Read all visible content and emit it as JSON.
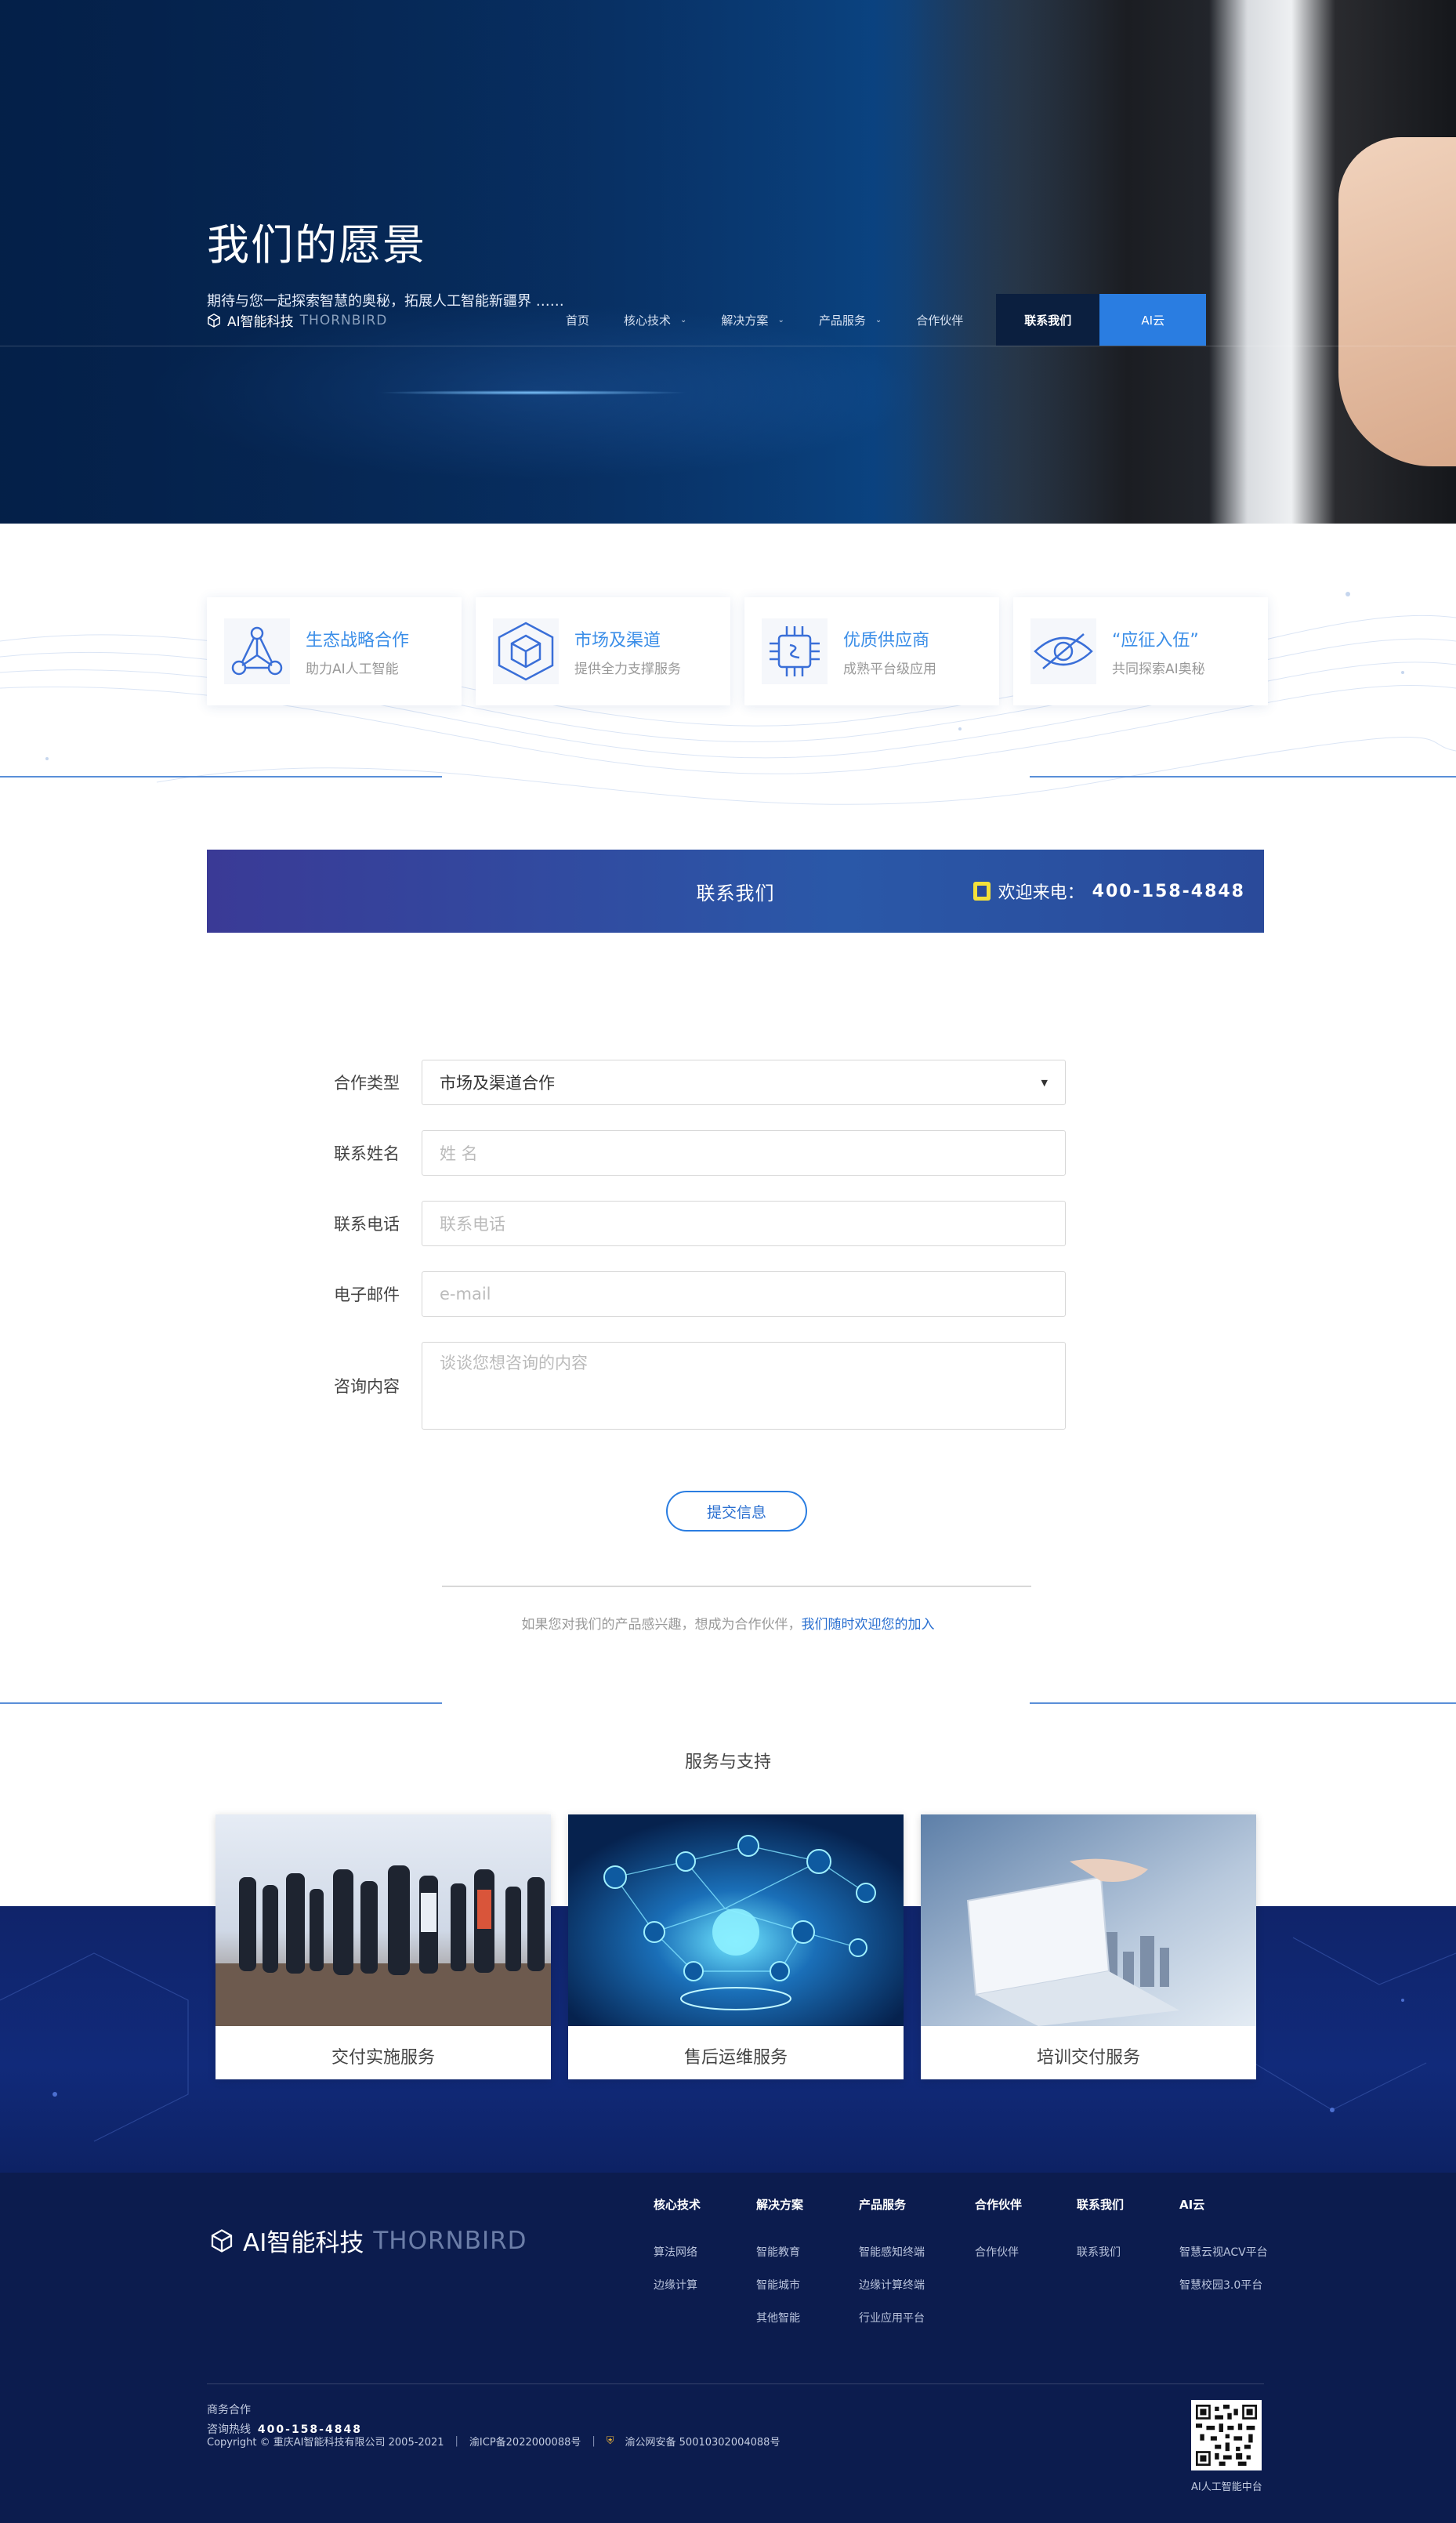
{
  "hero": {
    "title": "我们的愿景",
    "subtitle": "期待与您一起探索智慧的奥秘，拓展人工智能新疆界 ……"
  },
  "brand": {
    "name": "AI智能科技",
    "en": "THORNBIRD"
  },
  "nav": {
    "home": "首页",
    "core_tech": "核心技术",
    "solutions": "解决方案",
    "products": "产品服务",
    "partners": "合作伙伴",
    "contact": "联系我们",
    "ai_cloud": "AI云"
  },
  "features": [
    {
      "title": "生态战略合作",
      "desc": "助力AI人工智能",
      "icon": "network-icon"
    },
    {
      "title": "市场及渠道",
      "desc": "提供全力支撑服务",
      "icon": "cube-icon"
    },
    {
      "title": "优质供应商",
      "desc": "成熟平台级应用",
      "icon": "chip-icon"
    },
    {
      "title": "“应征入伍”",
      "desc": "共同探索AI奥秘",
      "icon": "eye-icon"
    }
  ],
  "banner": {
    "title": "联系我们",
    "welcome": "欢迎来电：",
    "phone": "400-158-4848"
  },
  "form": {
    "type_label": "合作类型",
    "type_value": "市场及渠道合作",
    "name_label": "联系姓名",
    "name_placeholder": "姓 名",
    "phone_label": "联系电话",
    "phone_placeholder": "联系电话",
    "email_label": "电子邮件",
    "email_placeholder": "e-mail",
    "content_label": "咨询内容",
    "content_placeholder": "谈谈您想咨询的内容",
    "submit": "提交信息"
  },
  "note": {
    "text": "如果您对我们的产品感兴趣，想成为合作伙伴，",
    "link": "我们随时欢迎您的加入"
  },
  "services": {
    "title": "服务与支持",
    "items": [
      "交付实施服务",
      "售后运维服务",
      "培训交付服务"
    ]
  },
  "footer": {
    "cols": [
      {
        "h": "核心技术",
        "links": [
          "算法网络",
          "边缘计算"
        ]
      },
      {
        "h": "解决方案",
        "links": [
          "智能教育",
          "智能城市",
          "其他智能"
        ]
      },
      {
        "h": "产品服务",
        "links": [
          "智能感知终端",
          "边缘计算终端",
          "行业应用平台"
        ]
      },
      {
        "h": "合作伙伴",
        "links": [
          "合作伙伴"
        ]
      },
      {
        "h": "联系我们",
        "links": [
          "联系我们"
        ]
      },
      {
        "h": "AI云",
        "links": [
          "智慧云视ACV平台",
          "智慧校园3.0平台"
        ]
      }
    ],
    "biz": "商务合作",
    "hotline_label": "咨询热线",
    "hotline": "400-158-4848",
    "copyright": "Copyright © 重庆AI智能科技有限公司 2005-2021",
    "icp": "渝ICP备2022000088号",
    "police": "渝公网安备 50010302004088号",
    "qr_label": "AI人工智能中台"
  },
  "colors": {
    "accent": "#2a7de1",
    "navy": "#0c1c4e",
    "banner": "#2a4a9a"
  }
}
